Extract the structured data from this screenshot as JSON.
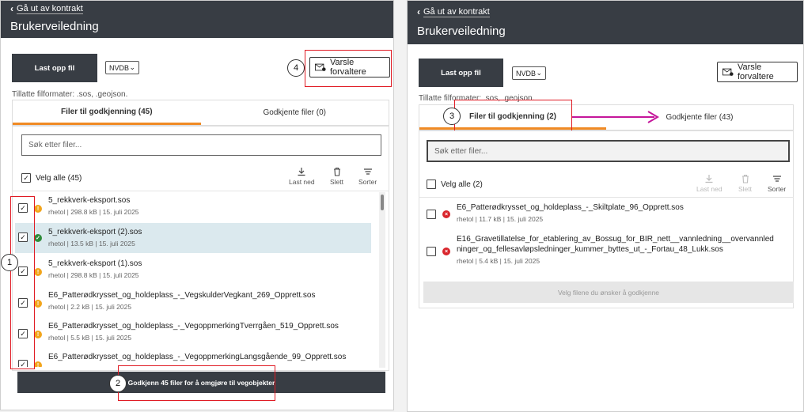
{
  "left": {
    "back_link": "Gå ut av kontrakt",
    "title": "Brukerveiledning",
    "upload_label": "Last opp fil",
    "select_value": "NVDB",
    "notify_label": "Varsle forvaltere",
    "formats": "Tillatte filformater: .sos, .geojson.",
    "tabs": [
      {
        "label": "Filer til godkjenning (45)",
        "active": true
      },
      {
        "label": "Godkjente filer (0)",
        "active": false
      }
    ],
    "search_placeholder": "Søk etter filer...",
    "select_all": "Velg alle (45)",
    "tools": {
      "download": "Last ned",
      "delete": "Slett",
      "sort": "Sorter"
    },
    "files": [
      {
        "name": "5_rekkverk-eksport.sos",
        "meta": "rhetol | 298.8 kB | 15. juli 2025",
        "status": "warn",
        "checked": true
      },
      {
        "name": "5_rekkverk-eksport (2).sos",
        "meta": "rhetol | 13.5 kB | 15. juli 2025",
        "status": "ok",
        "checked": true
      },
      {
        "name": "5_rekkverk-eksport (1).sos",
        "meta": "rhetol | 298.8 kB | 15. juli 2025",
        "status": "warn",
        "checked": true
      },
      {
        "name": "E6_Patterødkrysset_og_holdeplass_-_VegskulderVegkant_269_Opprett.sos",
        "meta": "rhetol | 2.2 kB | 15. juli 2025",
        "status": "warn",
        "checked": true
      },
      {
        "name": "E6_Patterødkrysset_og_holdeplass_-_VegoppmerkingTverrgåen_519_Opprett.sos",
        "meta": "rhetol | 5.5 kB | 15. juli 2025",
        "status": "warn",
        "checked": true
      },
      {
        "name": "E6_Patterødkrysset_og_holdeplass_-_VegoppmerkingLangsgående_99_Opprett.sos",
        "meta": "",
        "status": "warn",
        "checked": true
      }
    ],
    "approve_label": "Godkjenn 45 filer for å omgjøre til vegobjekter",
    "badges": [
      "1",
      "2",
      "4"
    ]
  },
  "right": {
    "back_link": "Gå ut av kontrakt",
    "title": "Brukerveiledning",
    "upload_label": "Last opp fil",
    "select_value": "NVDB",
    "notify_label": "Varsle forvaltere",
    "formats": "Tillatte filformater: .sos, .geojson.",
    "tabs": [
      {
        "label": "Filer til godkjenning (2)",
        "active": true
      },
      {
        "label": "Godkjente filer (43)",
        "active": false
      }
    ],
    "search_placeholder": "Søk etter filer...",
    "select_all": "Velg alle (2)",
    "tools": {
      "download": "Last ned",
      "delete": "Slett",
      "sort": "Sorter"
    },
    "files": [
      {
        "name": "E6_Patterødkrysset_og_holdeplass_-_Skiltplate_96_Opprett.sos",
        "meta": "rhetol | 11.7 kB | 15. juli 2025",
        "status": "err",
        "checked": false
      },
      {
        "name_line1": "E16_Gravetillatelse_for_etablering_av_Bossug_for_BIR_nett__vannledning__overvannled",
        "name_line2": "ninger_og_fellesavløpsledninger_kummer_byttes_ut_-_Fortau_48_Lukk.sos",
        "meta": "rhetol | 5.4 kB | 15. juli 2025",
        "status": "err",
        "checked": false
      }
    ],
    "approve_label": "Velg filene du ønsker å godkjenne",
    "badges": [
      "3"
    ]
  },
  "colors": {
    "topbar": "#383d44",
    "accent": "#f08a24",
    "annotation_red": "#e01b24",
    "arrow": "#c5169b",
    "highlight_row": "#dbe9ee"
  },
  "icons": [
    "chevron-left-icon",
    "envelope-icon",
    "download-icon",
    "trash-icon",
    "sort-icon",
    "warning-icon",
    "check-circle-icon",
    "error-icon",
    "checkbox-icon"
  ]
}
